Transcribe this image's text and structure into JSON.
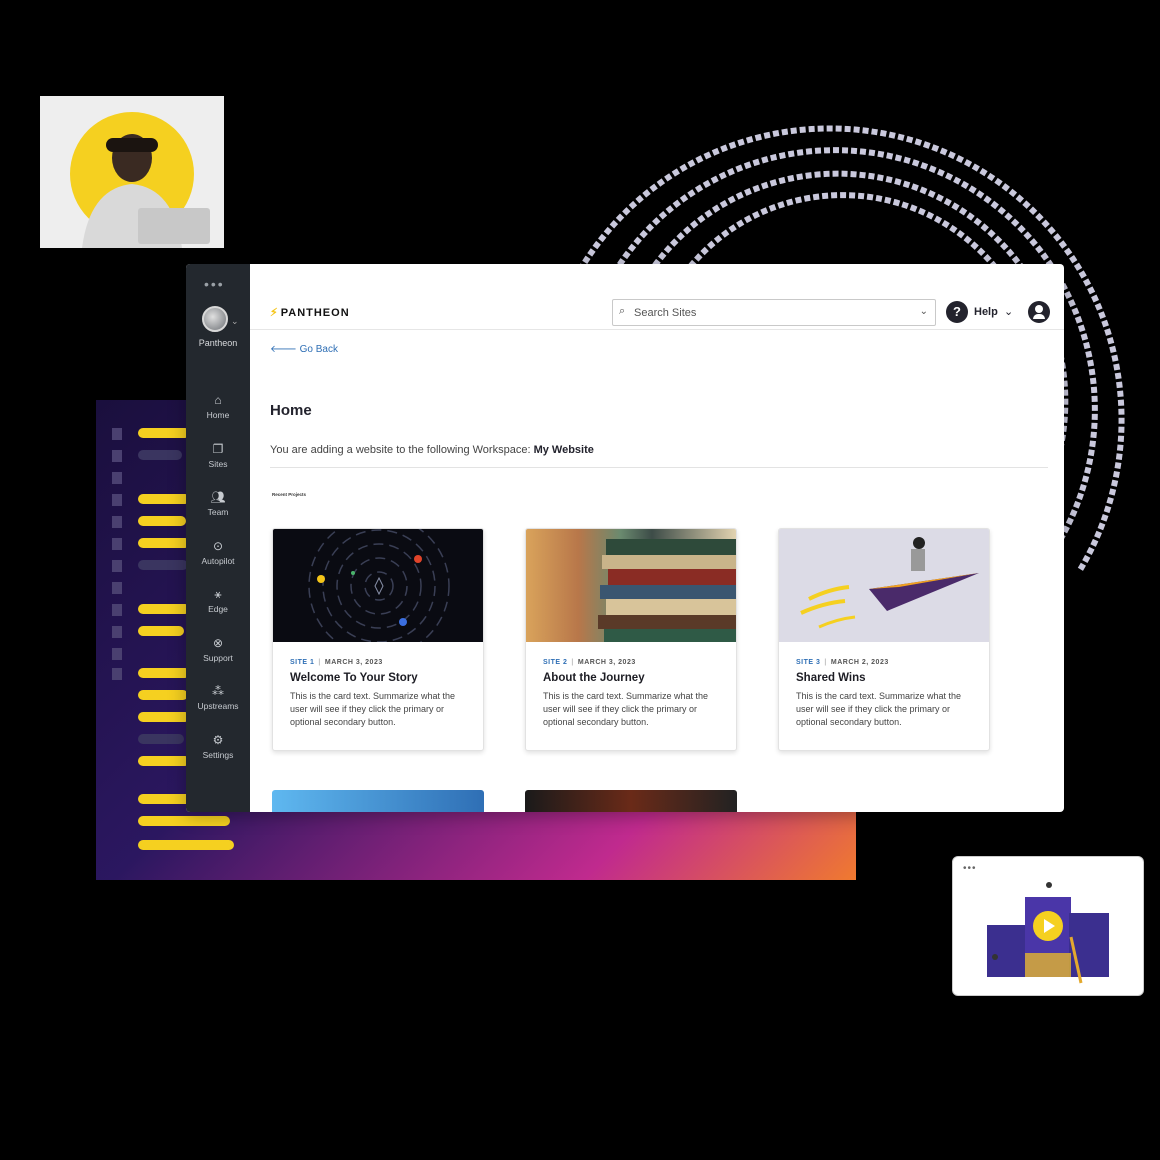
{
  "app": {
    "logo_text": "PANTHEON"
  },
  "sidebar": {
    "org_label": "Pantheon",
    "items": [
      {
        "label": "Home",
        "icon": "home-icon"
      },
      {
        "label": "Sites",
        "icon": "sites-icon"
      },
      {
        "label": "Team",
        "icon": "team-icon"
      },
      {
        "label": "Autopilot",
        "icon": "autopilot-icon"
      },
      {
        "label": "Edge",
        "icon": "edge-icon"
      },
      {
        "label": "Support",
        "icon": "support-icon"
      },
      {
        "label": "Upstreams",
        "icon": "upstreams-icon"
      },
      {
        "label": "Settings",
        "icon": "settings-icon"
      }
    ]
  },
  "header": {
    "search_placeholder": "Search Sites",
    "help_label": "Help"
  },
  "main": {
    "back_label": "Go Back",
    "title": "Home",
    "workspace_prefix": "You are adding a website to the following Workspace:",
    "workspace_name": "My Website",
    "recent_label": "Recent Projects",
    "cards": [
      {
        "site": "SITE 1",
        "date": "MARCH 3, 2023",
        "title": "Welcome To Your Story",
        "text": "This is the card text. Summarize what the user will see if they click the primary or optional secondary button."
      },
      {
        "site": "SITE 2",
        "date": "MARCH 3, 2023",
        "title": "About the Journey",
        "text": "This is the card text. Summarize what the user will see if they click the primary or optional secondary button."
      },
      {
        "site": "SITE 3",
        "date": "MARCH 2, 2023",
        "title": "Shared Wins",
        "text": "This is the card text. Summarize what the user will see if they click the primary or optional secondary button."
      }
    ]
  },
  "colors": {
    "accent": "#2f6fb5",
    "sidebar": "#23282e",
    "brand_yellow": "#f5c518"
  }
}
